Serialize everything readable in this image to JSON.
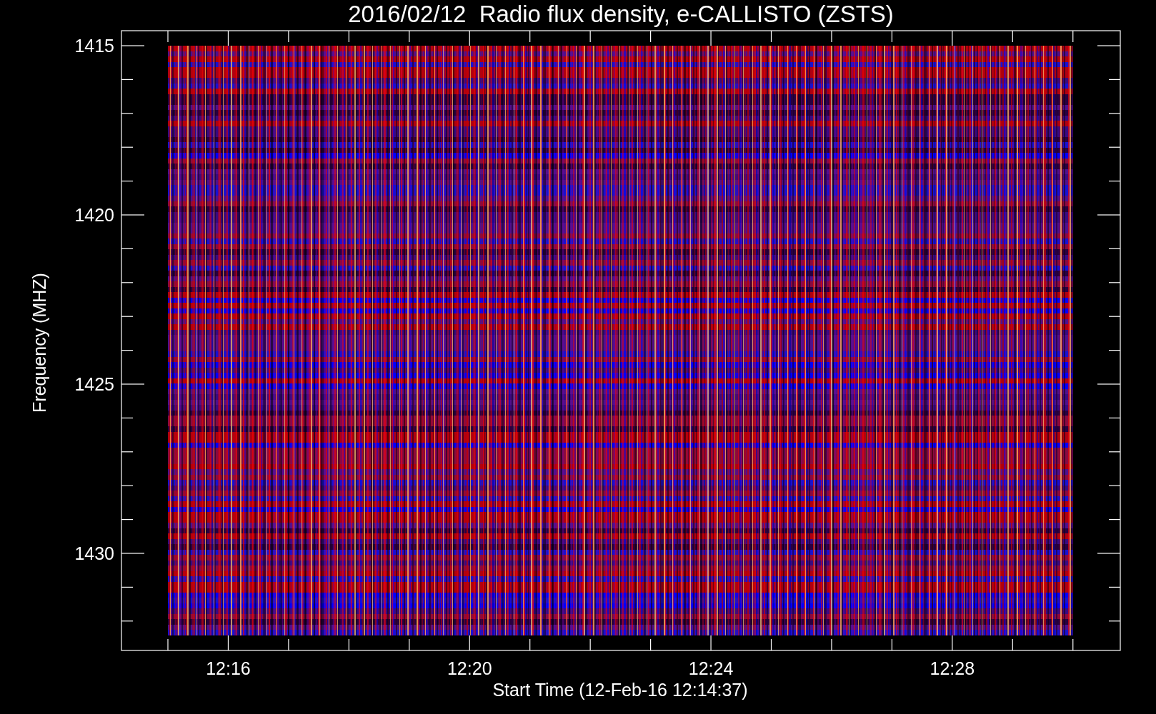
{
  "title": "2016/02/12  Radio flux density, e-CALLISTO (ZSTS)",
  "y_axis": {
    "label": "Frequency (MHZ)",
    "ticks": [
      "1415",
      "1420",
      "1425",
      "1430"
    ]
  },
  "x_axis": {
    "label": "Start Time (12-Feb-16 12:14:37)",
    "ticks": [
      "12:16",
      "12:20",
      "12:24",
      "12:28"
    ]
  }
}
